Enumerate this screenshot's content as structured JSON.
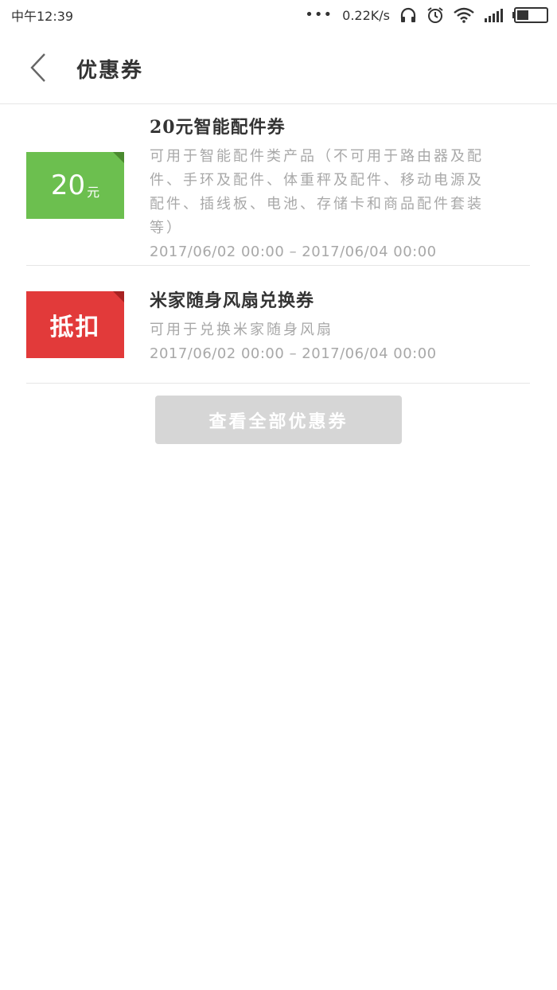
{
  "status_bar": {
    "carrier_time": "中午12:39",
    "dots": "•••",
    "net_speed": "0.22K/s",
    "icons": [
      "headset-icon",
      "alarm-icon",
      "wifi-icon",
      "signal-icon",
      "battery-icon"
    ]
  },
  "header": {
    "title": "优惠券",
    "back_icon": "chevron-left-icon"
  },
  "coupons": [
    {
      "badge_amount": "20",
      "badge_unit": "元",
      "badge_color": "#6cbf4f",
      "title": "20元智能配件券",
      "description": "可用于智能配件类产品（不可用于路由器及配件、手环及配件、体重秤及配件、移动电源及配件、插线板、电池、存储卡和商品配件套装等）",
      "validity": "2017/06/02 00:00 – 2017/06/04 00:00"
    },
    {
      "badge_text": "抵扣",
      "badge_color": "#e23a3a",
      "title": "米家随身风扇兑换券",
      "description": "可用于兑换米家随身风扇",
      "validity": "2017/06/02 00:00 – 2017/06/04 00:00"
    }
  ],
  "view_all_label": "查看全部优惠券"
}
